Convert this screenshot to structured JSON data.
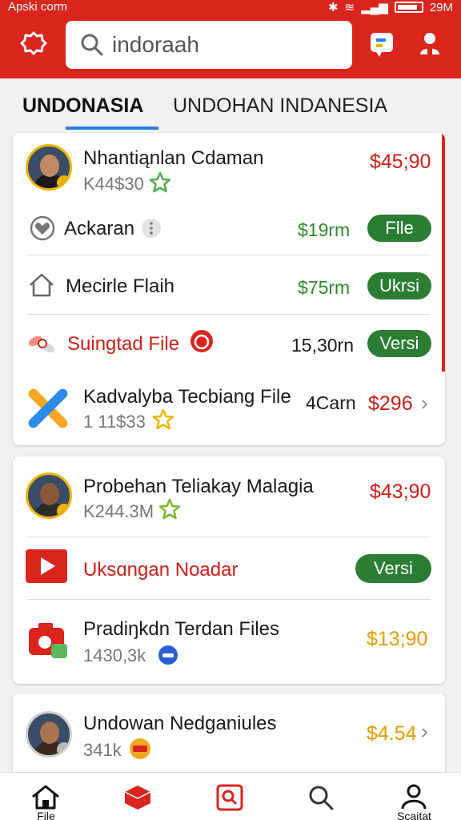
{
  "status_bar": {
    "left_text": "Apski corm",
    "right_text": "29M"
  },
  "header": {
    "search": {
      "value": "indoraah"
    }
  },
  "tabs": [
    {
      "label": "UNDONASIA",
      "active": true
    },
    {
      "label": "UNDOHAN INDANESIA",
      "active": false
    }
  ],
  "card1": {
    "profile": {
      "name": "Nhantiąnlan Cdaman",
      "sub": "K44$30",
      "price": "$45;90"
    },
    "rows": [
      {
        "label": "Ackaran",
        "price": "$19rm",
        "button": "Flle"
      },
      {
        "label": "Mecirle Flaih",
        "price": "$75rm",
        "button": "Ukrsi"
      },
      {
        "label": "Suingtad File",
        "price": "15,30rn",
        "button": "Versi"
      }
    ],
    "item": {
      "name": "Kadvalyba Tecbiang File",
      "sub": "1 11$33",
      "meta": "4Carn",
      "price": "$296"
    }
  },
  "card2": {
    "profile": {
      "name": "Probehan Teliakay Malagia",
      "sub": "K244.3M",
      "price": "$43;90"
    },
    "row": {
      "label": "Uksɑngan Noadar",
      "button": "Versi"
    },
    "item": {
      "name": "Pradiŋkdn Terdan Files",
      "sub": "1430,3k",
      "price": "$13;90"
    }
  },
  "card3": {
    "profile": {
      "name": "Undowan Nedganiules",
      "sub": "341k",
      "price": "$4.54"
    }
  },
  "bottom_nav": [
    {
      "label": "File",
      "icon": "home-icon"
    },
    {
      "label": "",
      "icon": "box-icon"
    },
    {
      "label": "",
      "icon": "search-box-icon"
    },
    {
      "label": "",
      "icon": "search-icon"
    },
    {
      "label": "Scaitat",
      "icon": "profile-icon"
    }
  ],
  "colors": {
    "brand": "#d9251c",
    "accent_green": "#2b7d34",
    "tab_indicator": "#2a7de1"
  }
}
